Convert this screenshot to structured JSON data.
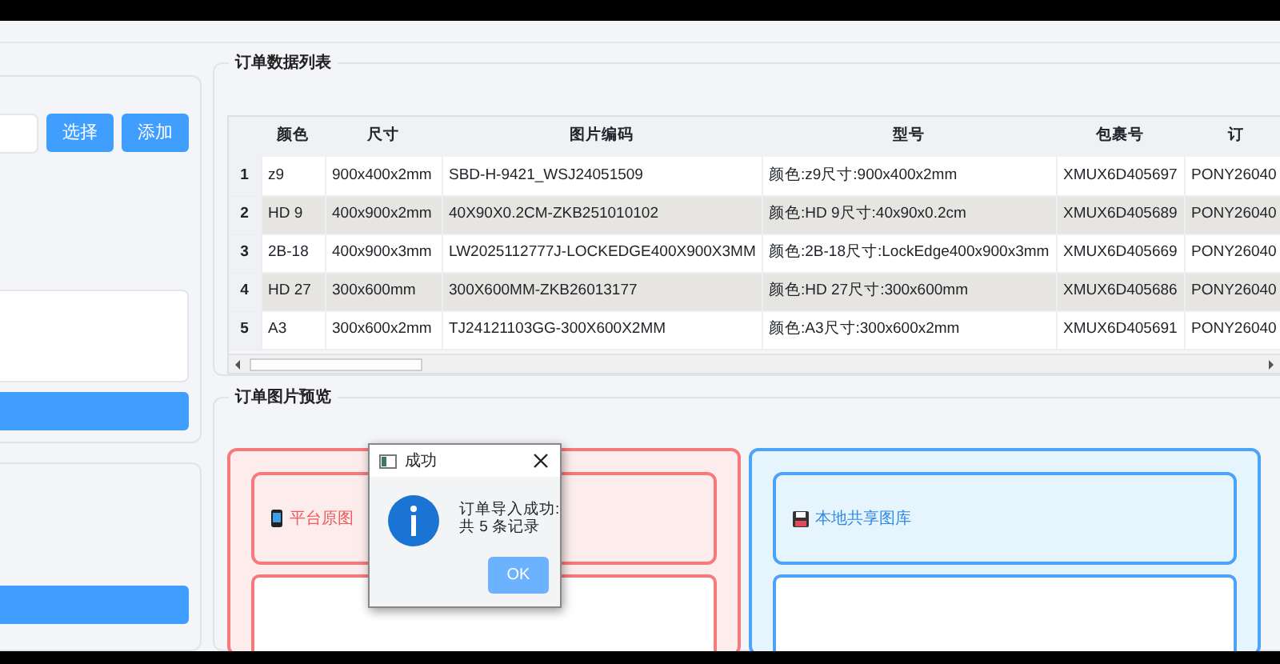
{
  "left_panel": {
    "select_button": "选择",
    "add_button": "添加"
  },
  "order_table": {
    "title": "订单数据列表",
    "columns": [
      "颜色",
      "尺寸",
      "图片编码",
      "型号",
      "包裹号",
      "订"
    ],
    "rows": [
      {
        "number": "1",
        "cells": [
          "z9",
          "900x400x2mm",
          "SBD-H-9421_WSJ24051509",
          "颜色:z9尺寸:900x400x2mm",
          "XMUX6D405697",
          "PONY26040"
        ]
      },
      {
        "number": "2",
        "cells": [
          "HD 9",
          "400x900x2mm",
          "40X90X0.2CM-ZKB251010102",
          "颜色:HD 9尺寸:40x90x0.2cm",
          "XMUX6D405689",
          "PONY26040"
        ]
      },
      {
        "number": "3",
        "cells": [
          "2B-18",
          "400x900x3mm",
          "LW2025112777J-LOCKEDGE400X900X3MM",
          "颜色:2B-18尺寸:LockEdge400x900x3mm",
          "XMUX6D405669",
          "PONY26040"
        ]
      },
      {
        "number": "4",
        "cells": [
          "HD 27",
          "300x600mm",
          "300X600MM-ZKB26013177",
          "颜色:HD 27尺寸:300x600mm",
          "XMUX6D405686",
          "PONY26040"
        ]
      },
      {
        "number": "5",
        "cells": [
          "A3",
          "300x600x2mm",
          "TJ24121103GG-300X600X2MM",
          "颜色:A3尺寸:300x600x2mm",
          "XMUX6D405691",
          "PONY26040"
        ]
      }
    ]
  },
  "preview": {
    "title": "订单图片预览",
    "sources": [
      {
        "kind": "platform",
        "label": "平台原图"
      },
      {
        "kind": "local",
        "label": "本地共享图库"
      }
    ]
  },
  "dialog": {
    "title": "成功",
    "message_lines": [
      "订单导入成功:",
      "共 5 条记录"
    ],
    "ok_button": "OK"
  }
}
